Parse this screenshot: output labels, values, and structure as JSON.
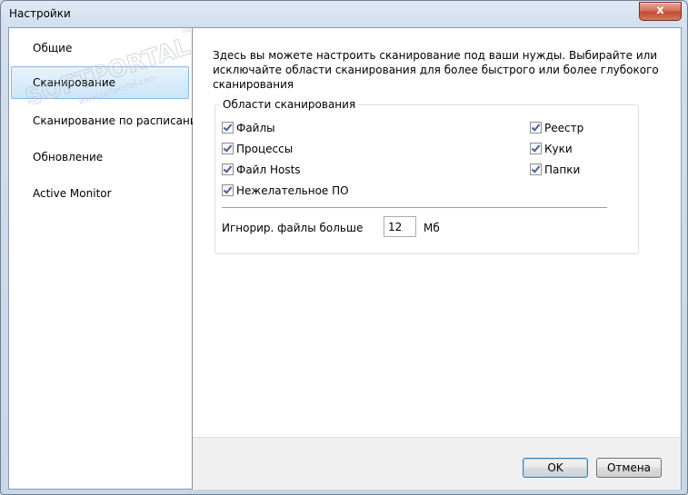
{
  "window": {
    "title": "Настройки",
    "close_symbol": "x"
  },
  "sidebar": {
    "items": [
      {
        "label": "Общие"
      },
      {
        "label": "Сканирование",
        "selected": true
      },
      {
        "label": "Сканирование по расписанию"
      },
      {
        "label": "Обновление"
      },
      {
        "label": "Active Monitor"
      }
    ]
  },
  "main": {
    "description": "Здесь вы можете настроить сканирование под ваши нужды. Выбирайте или исключайте области сканирования для более быстрого или более глубокого сканирования",
    "group": {
      "title": "Области сканирования",
      "left_options": [
        {
          "label": "Файлы",
          "checked": true
        },
        {
          "label": "Процессы",
          "checked": true
        },
        {
          "label": "Файл Hosts",
          "checked": true
        },
        {
          "label": "Нежелательное ПО",
          "checked": true
        }
      ],
      "right_options": [
        {
          "label": "Реестр",
          "checked": true
        },
        {
          "label": "Куки",
          "checked": true
        },
        {
          "label": "Папки",
          "checked": true
        }
      ],
      "ignore_label": "Игнорир. файлы больше",
      "ignore_value": "12",
      "unit": "Мб"
    }
  },
  "footer": {
    "ok_label": "OK",
    "cancel_label": "Отмена"
  },
  "watermark": {
    "main": "SOFTPORTAL",
    "sub": "www.softportal.com",
    "tm": "TM"
  }
}
